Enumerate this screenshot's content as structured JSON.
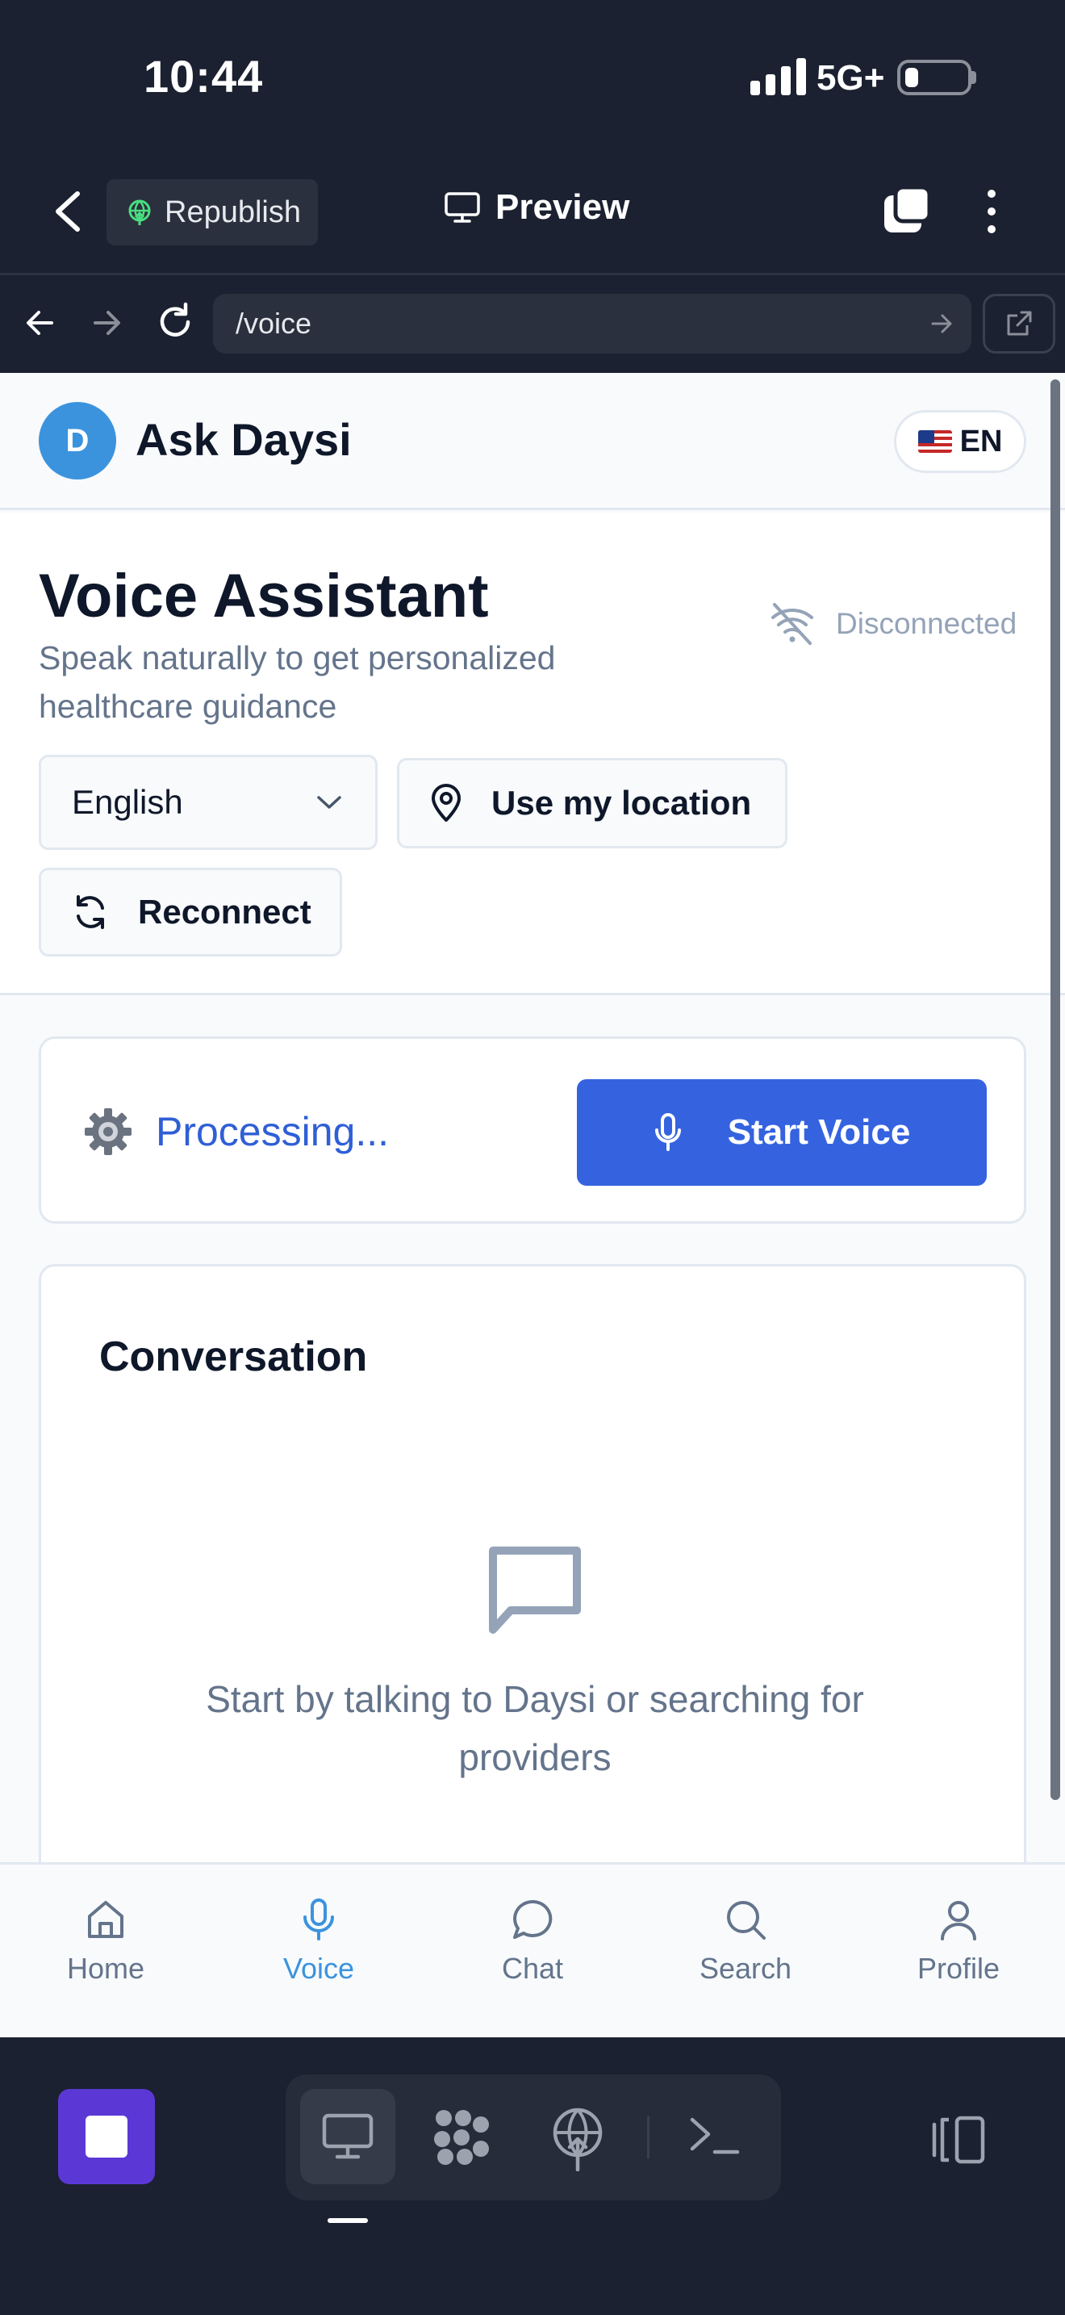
{
  "status_bar": {
    "time": "10:44",
    "network": "5G+"
  },
  "toolbar": {
    "republish_label": "Republish",
    "preview_label": "Preview"
  },
  "browser": {
    "url": "/voice"
  },
  "app": {
    "avatar_letter": "D",
    "title": "Ask Daysi",
    "language_pill": "EN"
  },
  "intro": {
    "title": "Voice Assistant",
    "subtitle": "Speak naturally to get personalized healthcare guidance",
    "connection_status": "Disconnected",
    "language_select": "English",
    "location_button": "Use my location",
    "reconnect_button": "Reconnect"
  },
  "voice_card": {
    "status_text": "Processing...",
    "start_button": "Start Voice"
  },
  "conversation": {
    "title": "Conversation",
    "empty_text": "Start by talking to Daysi or searching for providers"
  },
  "bottom_nav": [
    {
      "label": "Home",
      "icon": "home-icon",
      "active": false
    },
    {
      "label": "Voice",
      "icon": "mic-icon",
      "active": true
    },
    {
      "label": "Chat",
      "icon": "chat-icon",
      "active": false
    },
    {
      "label": "Search",
      "icon": "search-icon",
      "active": false
    },
    {
      "label": "Profile",
      "icon": "user-icon",
      "active": false
    }
  ],
  "colors": {
    "accent": "#3563e0",
    "active_nav": "#3b93dd",
    "avatar": "#3b93dd",
    "stop_button": "#5b38d6"
  }
}
